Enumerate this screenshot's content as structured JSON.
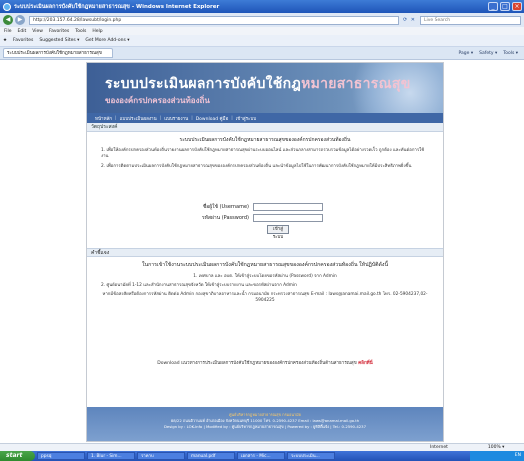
{
  "window": {
    "title": "ระบบประเมินผลการบังคับใช้กฎหมายสาธารณสุข - Windows Internet Explorer"
  },
  "address": {
    "url": "http://203.157.64.28/lawsubt/login.php",
    "search_placeholder": "Live Search"
  },
  "menu": [
    "File",
    "Edit",
    "View",
    "Favorites",
    "Tools",
    "Help"
  ],
  "favorites": {
    "label": "Favorites",
    "items": [
      "Suggested Sites ▾",
      "Get More Add-ons ▾"
    ]
  },
  "tab": {
    "label": "ระบบประเมินผลการบังคับใช้กฎหมายสาธารณสุข"
  },
  "commandbar": [
    "Page ▾",
    "Safety ▾",
    "Tools ▾"
  ],
  "page": {
    "banner_title_a": "ระบบประเมินผลการบังคับใช้กฎ",
    "banner_title_b": "หมายสาธารณสุข",
    "banner_subtitle": "ขององค์กรปกครองส่วนท้องถิ่น",
    "nav": [
      "หน้าหลัก",
      "แบบประเมินผลงาน",
      "แบบรายงาน",
      "Download คู่มือ",
      "เข้าสู่ระบบ"
    ],
    "objective_header": "วัตถุประสงค์",
    "objective_title": "ระบบประเมินผลการบังคับใช้กฎหมายสาธารณสุขขององค์กรปกครองส่วนท้องถิ่น",
    "objective_p1": "1. เพื่อให้องค์กรปกครองส่วนท้องถิ่นรายงานผลการบังคับใช้กฎหมายสาธารณสุขผ่านระบบออนไลน์ และส่วนกลางสามารถรวบรวมข้อมูลได้อย่างรวดเร็ว ถูกต้อง และทันต่อการใช้งาน",
    "objective_p2": "2. เพื่อการติดตามประเมินผลการบังคับใช้กฎหมายสาธารณสุขขององค์กรปกครองส่วนท้องถิ่น และนำข้อมูลไปใช้ในการพัฒนาการบังคับใช้กฎหมายให้มีประสิทธิภาพยิ่งขึ้น",
    "login": {
      "username_label": "ชื่อผู้ใช้ (Username)",
      "password_label": "รหัสผ่าน (Password)",
      "submit": "เข้าสู่ระบบ"
    },
    "howto_header": "คำชี้แจง",
    "howto_title": "ในการเข้าใช้งานระบบประเมินผลการบังคับใช้กฎหมายสาธารณสุขขององค์กรปกครองส่วนท้องถิ่น ให้ปฏิบัติดังนี้",
    "howto_p1": "1. เทศบาล และ อบต. ให้เข้าสู่ระบบโดยขอรหัสผ่าน (Password) จาก Admin",
    "howto_p2": "2. ศูนย์อนามัยที่ 1-12 และสำนักงานสาธารณสุขจังหวัด ให้เข้าสู่ระบบรายงาน และขอรหัสผ่านจาก Admin",
    "howto_p3": "หากมีข้อสงสัยหรือต้องการรหัสผ่าน ติดต่อ Admin กองสุขาภิบาลอาหารและน้ำ กรมอนามัย กระทรวงสาธารณสุข E-mail : laws@anamai.mail.go.th โทร. 02-5904237,02-5904225",
    "download_text": "Download แนวทางการประเมินผลการบังคับใช้กฎหมายขององค์กรปกครองส่วนท้องถิ่นด้านสาธารณสุข",
    "download_link": "คลิกที่นี่",
    "footer_line1": "ศูนย์บริหารกฎหมายสาธารณสุข กรมอนามัย",
    "footer_line2": "88/22 ถนนติวานนท์ อำเภอเมือง จังหวัดนนทบุรี 11000 โทร. 0-2590-4237 Email : laws@anamai.mail.go.th",
    "footer_line3": "Design by : LOK-Info | Modified by : ศูนย์บริหารกฎหมายสาธารณสุข | Powered by : ยูทิลิตี้แจ้ง | Tel.: 0-2590-4237"
  },
  "status": {
    "zone": "Internet",
    "zoom": "100% ▾"
  },
  "taskbar": {
    "start": "start",
    "items": [
      "ppsq",
      "1. Blur - Sim...",
      "ราคาบ",
      "manual.pdf",
      "เอกสาร - Mic...",
      "ระบบประเมิน..."
    ],
    "clock": "EN"
  }
}
